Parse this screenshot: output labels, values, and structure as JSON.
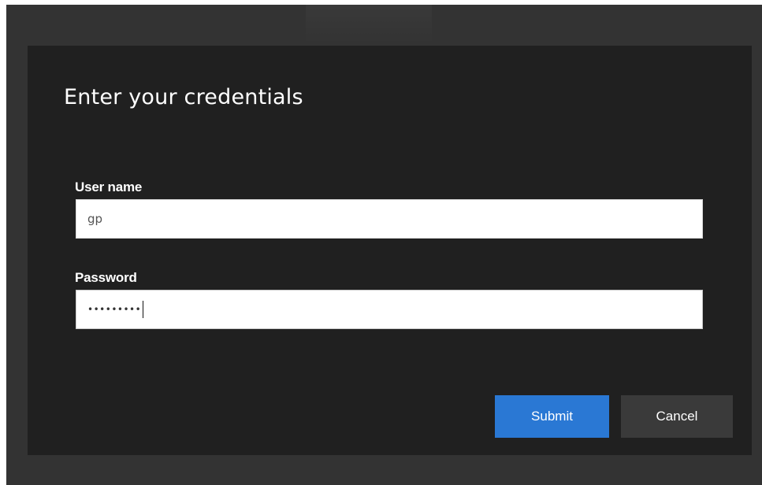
{
  "dialog": {
    "title": "Enter your credentials",
    "username": {
      "label": "User name",
      "value": "gp"
    },
    "password": {
      "label": "Password",
      "masked_value": "•••••••••"
    },
    "buttons": {
      "submit_label": "Submit",
      "cancel_label": "Cancel"
    }
  },
  "colors": {
    "backdrop": "#333333",
    "dialog_background": "#202020",
    "submit_button": "#2a78d4",
    "cancel_button": "#3a3a3a",
    "text_primary": "#ffffff"
  }
}
